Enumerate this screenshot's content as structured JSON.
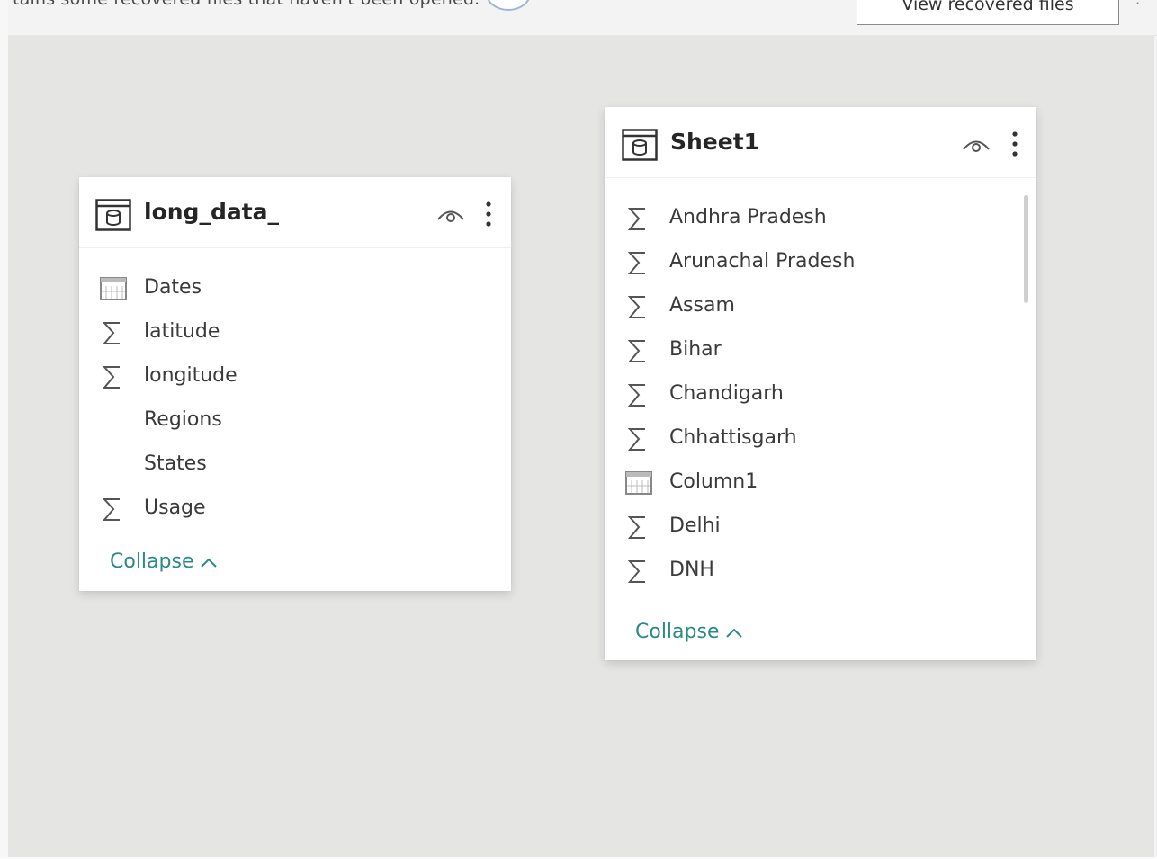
{
  "recovery_bar": {
    "message": "tains some recovered files that haven't been opened.",
    "button_label": "View recovered files"
  },
  "tables": [
    {
      "title": "long_data_",
      "fields": [
        {
          "label": "Dates",
          "icon": "calendar-icon"
        },
        {
          "label": "latitude",
          "icon": "sigma-icon"
        },
        {
          "label": "longitude",
          "icon": "sigma-icon"
        },
        {
          "label": "Regions",
          "icon": ""
        },
        {
          "label": "States",
          "icon": ""
        },
        {
          "label": "Usage",
          "icon": "sigma-icon"
        }
      ],
      "collapse_label": "Collapse"
    },
    {
      "title": "Sheet1",
      "fields": [
        {
          "label": "Andhra Pradesh",
          "icon": "sigma-icon"
        },
        {
          "label": "Arunachal Pradesh",
          "icon": "sigma-icon"
        },
        {
          "label": "Assam",
          "icon": "sigma-icon"
        },
        {
          "label": "Bihar",
          "icon": "sigma-icon"
        },
        {
          "label": "Chandigarh",
          "icon": "sigma-icon"
        },
        {
          "label": "Chhattisgarh",
          "icon": "sigma-icon"
        },
        {
          "label": "Column1",
          "icon": "calendar-icon"
        },
        {
          "label": "Delhi",
          "icon": "sigma-icon"
        },
        {
          "label": "DNH",
          "icon": "sigma-icon"
        }
      ],
      "collapse_label": "Collapse"
    }
  ],
  "colors": {
    "canvas": "#e5e5e4",
    "card": "#ffffff",
    "collapse_link": "#2a8b84",
    "field_text": "#3a3a3a"
  }
}
